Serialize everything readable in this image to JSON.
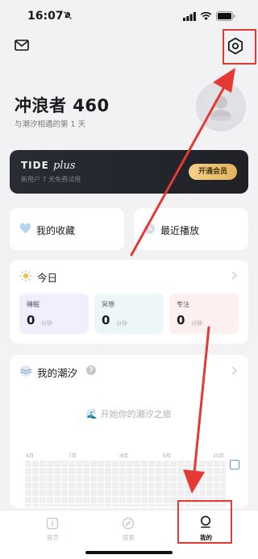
{
  "status_bar": {
    "time": "16:07"
  },
  "profile": {
    "username": "冲浪者 460",
    "days_text": "与潮汐相遇的第 1 天"
  },
  "membership": {
    "brand": "TIDE",
    "brand_suffix": "plus",
    "subtitle": "新用户 7 天免费试用",
    "button": "开通会员"
  },
  "quick_links": [
    {
      "label": "我的收藏",
      "icon": "heart-icon"
    },
    {
      "label": "最近播放",
      "icon": "clock-icon"
    }
  ],
  "today": {
    "title": "今日",
    "stats": [
      {
        "label": "睡眠",
        "value": "0",
        "unit": "分钟",
        "color": "#f0effb"
      },
      {
        "label": "冥想",
        "value": "0",
        "unit": "分钟",
        "color": "#eef7f7"
      },
      {
        "label": "专注",
        "value": "0",
        "unit": "分钟",
        "color": "#fdf0ee"
      }
    ]
  },
  "my_tide": {
    "title": "我的潮汐",
    "help": "?",
    "empty_text": "🌊 开始你的潮汐之旅",
    "months": [
      "4月",
      "7月",
      "8月",
      "9月",
      "10月"
    ]
  },
  "tabs": [
    {
      "label": "首页",
      "icon": "home-icon"
    },
    {
      "label": "探索",
      "icon": "compass-icon"
    },
    {
      "label": "我的",
      "icon": "profile-icon",
      "active": true
    }
  ],
  "colors": {
    "annotation": "#e53935",
    "accent_gold": "#e2b35e",
    "card_dark": "#23252b"
  }
}
